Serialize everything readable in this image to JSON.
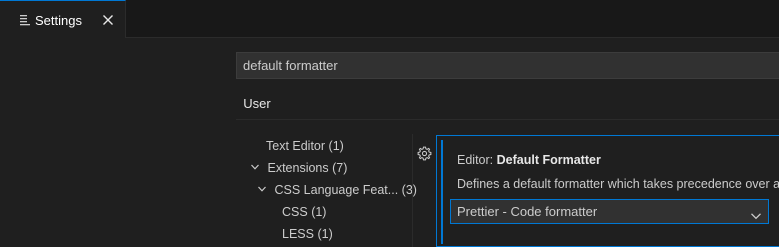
{
  "tab": {
    "label": "Settings",
    "icon": "settings-file-icon",
    "close_icon": "close-icon"
  },
  "search": {
    "value": "default formatter"
  },
  "scope": {
    "user_label": "User"
  },
  "toc": {
    "text_editor": {
      "label": "Text Editor",
      "count": "(1)"
    },
    "extensions": {
      "label": "Extensions",
      "count": "(7)"
    },
    "css_language": {
      "label": "CSS Language Feat...",
      "count": "(3)"
    },
    "css": {
      "label": "CSS",
      "count": "(1)"
    },
    "less": {
      "label": "LESS",
      "count": "(1)"
    }
  },
  "setting": {
    "category": "Editor:",
    "name": "Default Formatter",
    "description": "Defines a default formatter which takes precedence over a",
    "selected_value": "Prettier - Code formatter",
    "gear_icon": "gear-icon"
  },
  "colors": {
    "accent": "#0078d4",
    "background": "#1f1f1f"
  }
}
